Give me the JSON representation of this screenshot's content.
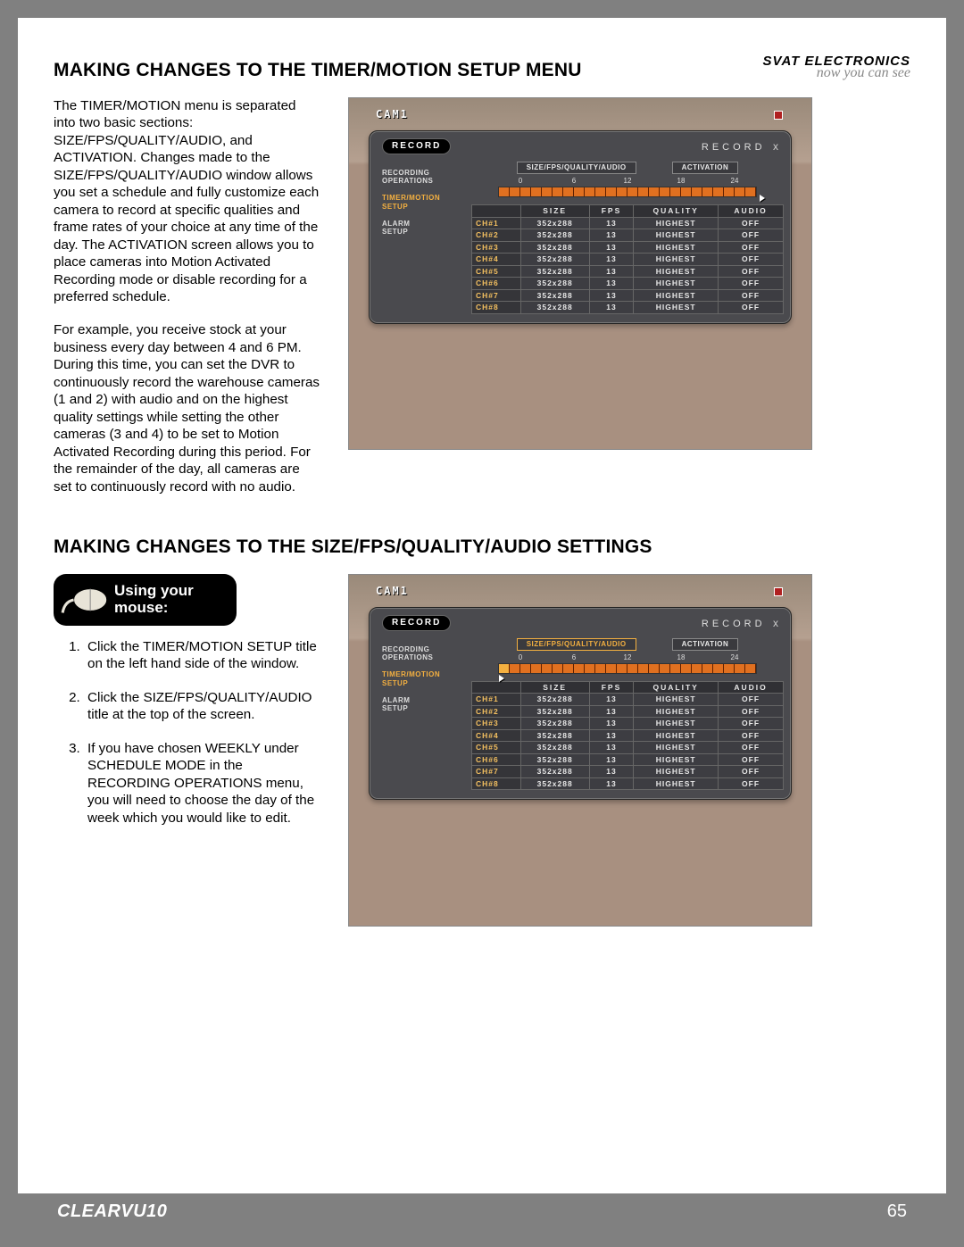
{
  "header": {
    "brand": "SVAT ELECTRONICS",
    "tagline": "now you can see"
  },
  "section1": {
    "title": "MAKING CHANGES TO THE TIMER/MOTION SETUP MENU",
    "para1": "The TIMER/MOTION menu is separated into two basic sections:  SIZE/FPS/QUALITY/AUDIO, and ACTIVATION.  Changes made to the SIZE/FPS/QUALITY/AUDIO window allows you set a schedule and fully customize each camera to record at specific qualities and frame rates of your choice at any time of the day.  The ACTIVATION screen allows you to place cameras into Motion Activated Recording mode or disable recording for a preferred schedule.",
    "para2": "For example, you receive stock at your business every day between 4 and 6 PM.  During this time, you can set the DVR to continuously record the warehouse cameras (1 and 2) with audio and on the highest quality settings while setting the other cameras (3 and 4) to be set to Motion Activated Recording during this period.  For the remainder of the day, all cameras are set to continuously record with no audio."
  },
  "section2": {
    "title": "MAKING CHANGES TO THE SIZE/FPS/QUALITY/AUDIO SETTINGS",
    "mouse_badge": "Using your mouse:",
    "steps": [
      "Click the TIMER/MOTION SETUP title on the left hand side of the window.",
      "Click the SIZE/FPS/QUALITY/AUDIO title at the top of the screen.",
      "If you have chosen WEEKLY under SCHEDULE MODE in the RECORDING OPERATIONS menu, you will need to choose the day of the week which you would like to edit."
    ]
  },
  "dvr": {
    "cam": "CAM1",
    "panel_title": "RECORD",
    "panel_right": "RECORD",
    "close": "x",
    "side": [
      {
        "lines": [
          "RECORDING",
          "OPERATIONS"
        ],
        "active": false
      },
      {
        "lines": [
          "TIMER/MOTION",
          "SETUP"
        ],
        "active": true
      },
      {
        "lines": [
          "ALARM",
          "SETUP"
        ],
        "active": false
      }
    ],
    "tabs": {
      "a": "SIZE/FPS/QUALITY/AUDIO",
      "b": "ACTIVATION"
    },
    "ticks": [
      "0",
      "6",
      "12",
      "18",
      "24"
    ],
    "cols": [
      "",
      "SIZE",
      "FPS",
      "QUALITY",
      "AUDIO"
    ],
    "rows": [
      [
        "CH#1",
        "352x288",
        "13",
        "HIGHEST",
        "OFF"
      ],
      [
        "CH#2",
        "352x288",
        "13",
        "HIGHEST",
        "OFF"
      ],
      [
        "CH#3",
        "352x288",
        "13",
        "HIGHEST",
        "OFF"
      ],
      [
        "CH#4",
        "352x288",
        "13",
        "HIGHEST",
        "OFF"
      ],
      [
        "CH#5",
        "352x288",
        "13",
        "HIGHEST",
        "OFF"
      ],
      [
        "CH#6",
        "352x288",
        "13",
        "HIGHEST",
        "OFF"
      ],
      [
        "CH#7",
        "352x288",
        "13",
        "HIGHEST",
        "OFF"
      ],
      [
        "CH#8",
        "352x288",
        "13",
        "HIGHEST",
        "OFF"
      ]
    ]
  },
  "footer": {
    "model": "CLEARVU10",
    "page": "65"
  }
}
